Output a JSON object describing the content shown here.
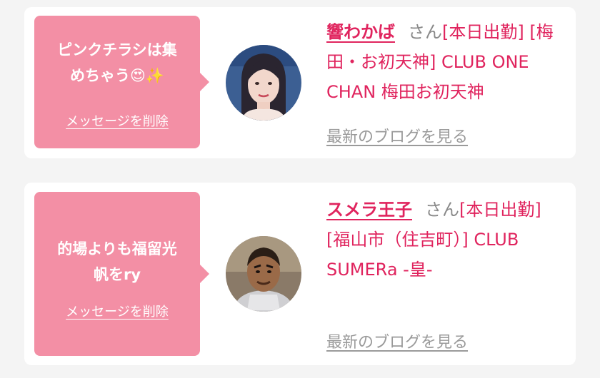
{
  "colors": {
    "page_bg": "#f4f4f4",
    "card_bg": "#ffffff",
    "bubble_bg": "#f38fa5",
    "accent_pink": "#e0245e",
    "muted_gray": "#9a9a9a"
  },
  "items": [
    {
      "message": "ピンクチラシは集\nめちゃう😍✨",
      "delete_label": "メッセージを削除",
      "name": "響わかば",
      "honorific": "さん",
      "details": "[本日出勤] [梅田・お初天神] CLUB ONE CHAN 梅田お初天神",
      "blog_label": "最新のブログを見る"
    },
    {
      "message": "的場よりも福留光\n帆をry",
      "delete_label": "メッセージを削除",
      "name": "スメラ王子",
      "honorific": "さん",
      "details": "[本日出勤] [福山市（住吉町）] CLUB SUMERa -皇-",
      "blog_label": "最新のブログを見る"
    }
  ]
}
